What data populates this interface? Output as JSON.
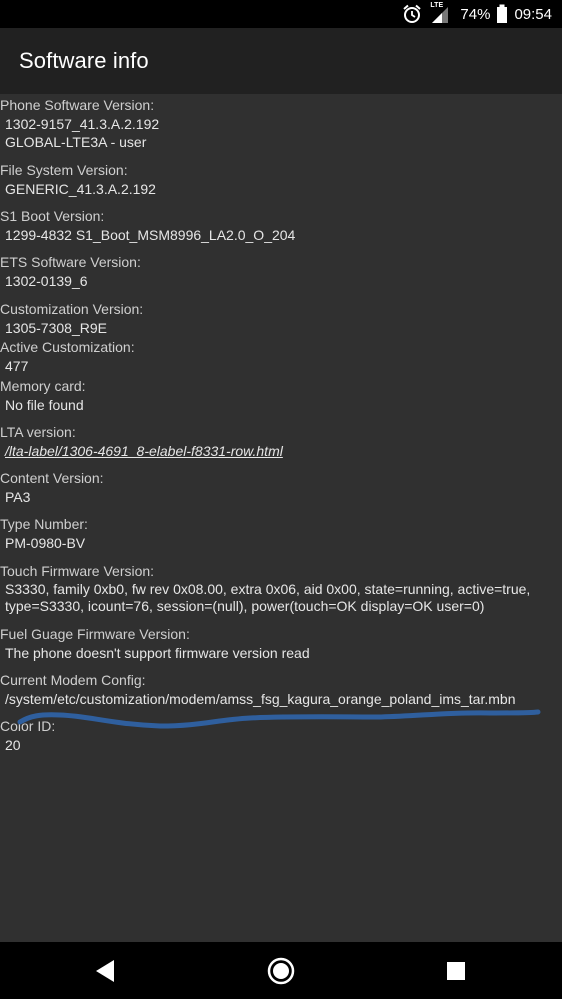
{
  "status_bar": {
    "network": "LTE",
    "battery": "74%",
    "time": "09:54",
    "icons": [
      "alarm-icon",
      "signal-icon",
      "battery-icon"
    ]
  },
  "app_bar": {
    "title": "Software info"
  },
  "entries": [
    {
      "label": "Phone Software Version:",
      "lines": [
        "1302-9157_41.3.A.2.192",
        "GLOBAL-LTE3A - user"
      ]
    },
    {
      "label": "File System Version:",
      "lines": [
        "GENERIC_41.3.A.2.192"
      ]
    },
    {
      "label": "S1 Boot Version:",
      "lines": [
        "1299-4832 S1_Boot_MSM8996_LA2.0_O_204"
      ]
    },
    {
      "label": "ETS Software Version:",
      "lines": [
        "1302-0139_6"
      ]
    },
    {
      "label": "Customization Version:",
      "lines": [
        "1305-7308_R9E"
      ]
    },
    {
      "label": "Active Customization:",
      "lines": [
        "477"
      ]
    },
    {
      "label": "Memory card:",
      "lines": [
        "No file found"
      ]
    },
    {
      "label": "LTA version:",
      "lines": [
        "/lta-label/1306-4691_8-elabel-f8331-row.html"
      ]
    },
    {
      "label": "Content Version:",
      "lines": [
        "PA3"
      ]
    },
    {
      "label": "Type Number:",
      "lines": [
        "PM-0980-BV"
      ]
    },
    {
      "label": "Touch Firmware Version:",
      "lines": [
        "S3330, family 0xb0, fw rev 0x08.00, extra 0x06, aid 0x00, state=running, active=true, type=S3330, icount=76, session=(null), power(touch=OK display=OK user=0)"
      ]
    },
    {
      "label": "Fuel Guage Firmware Version:",
      "lines": [
        "The phone doesn't support firmware version read"
      ]
    },
    {
      "label": "Current Modem Config:",
      "lines": [
        "/system/etc/customization/modem/amss_fsg_kagura_orange_poland_ims_tar.mbn"
      ]
    },
    {
      "label": "Color ID:",
      "lines": [
        "20"
      ]
    }
  ],
  "annotation": {
    "color": "#2f5f9e"
  },
  "nav_bar": {
    "icons": [
      "back-icon",
      "home-icon",
      "recents-icon"
    ]
  }
}
